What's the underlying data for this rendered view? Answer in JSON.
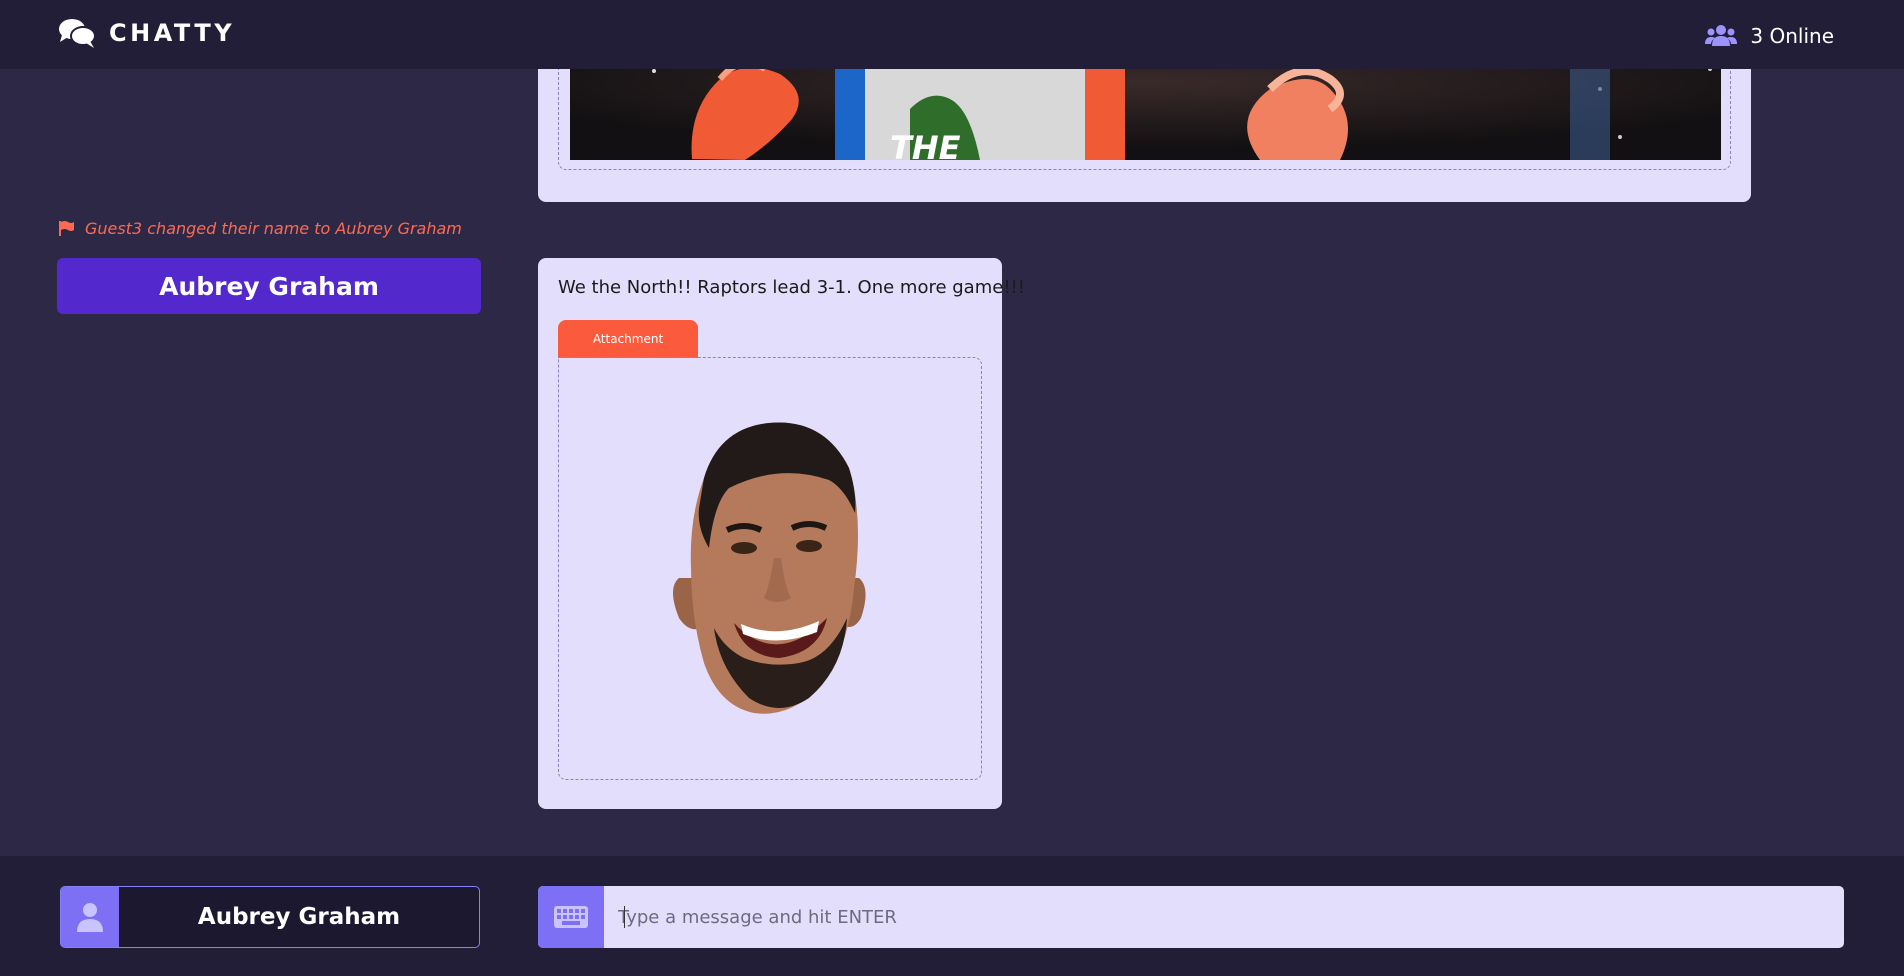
{
  "header": {
    "brand": "CHATTY",
    "brand_icon": "comments-icon",
    "online_icon": "users-icon",
    "online_count": "3 Online"
  },
  "feed": {
    "previous_message": {
      "attachment_image": "photo-attachment"
    },
    "system_notice": {
      "icon": "flag-icon",
      "text": "Guest3 changed their name to Aubrey Graham"
    },
    "author_badge": "Aubrey Graham",
    "message": {
      "text": "We the North!! Raptors lead 3-1. One more game!!!",
      "attachment_label": "Attachment",
      "attachment_image": "face-photo"
    }
  },
  "footer": {
    "user_icon": "user-icon",
    "user_name": "Aubrey Graham",
    "keyboard_icon": "keyboard-icon",
    "input_placeholder": "Type a message and hit ENTER",
    "input_value": ""
  },
  "colors": {
    "background": "#2e2847",
    "header_bg": "#221e37",
    "accent_purple": "#5328cc",
    "accent_lavender": "#7d70f5",
    "card_bg": "#e2defc",
    "notice_red": "#fb6a52",
    "attachment_orange": "#fb5a3c"
  }
}
